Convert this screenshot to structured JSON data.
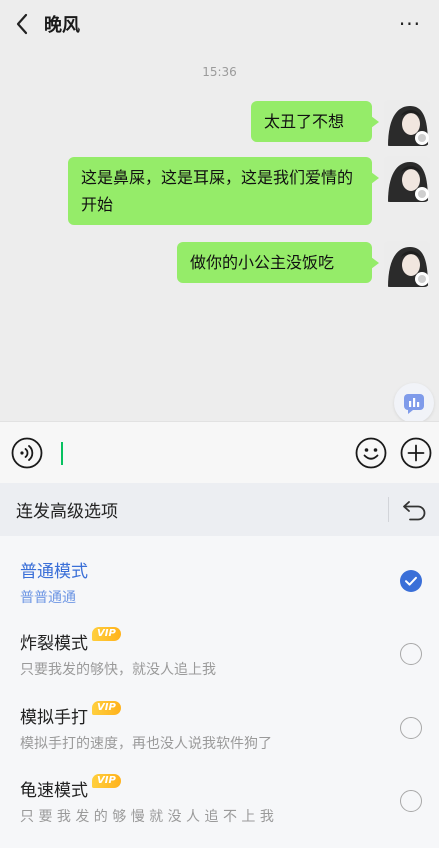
{
  "header": {
    "title": "晚风",
    "more_label": "···"
  },
  "chat": {
    "timestamp": "15:36",
    "messages": [
      {
        "text": "太丑了不想"
      },
      {
        "text": "这是鼻屎，这是耳屎，这是我们爱情的开始"
      },
      {
        "text": "做你的小公主没饭吃"
      }
    ]
  },
  "panel": {
    "title": "连发高级选项",
    "options": [
      {
        "title": "普通模式",
        "desc": "普普通通",
        "vip": "",
        "selected": true
      },
      {
        "title": "炸裂模式",
        "desc": "只要我发的够快，就没人追上我",
        "vip": "VIP",
        "selected": false
      },
      {
        "title": "模拟手打",
        "desc": "模拟手打的速度，再也没人说我软件狗了",
        "vip": "VIP",
        "selected": false
      },
      {
        "title": "龟速模式",
        "desc": "只 要 我 发 的 够 慢 就 没 人 追 不 上 我",
        "vip": "VIP",
        "selected": false
      }
    ]
  },
  "colors": {
    "bubble": "#95ec69",
    "accent": "#3a6fd8",
    "cursor": "#07c160",
    "vip": "#ffc12b"
  }
}
